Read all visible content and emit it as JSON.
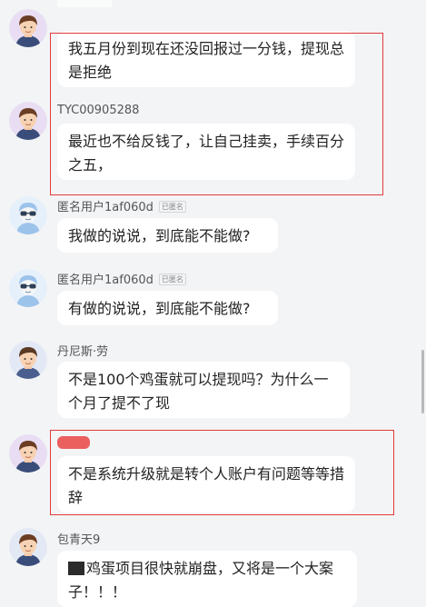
{
  "messages": [
    {
      "name": "",
      "anonymous": false,
      "avatar_icon": "man-avatar-icon",
      "text": "我五月份到现在还没回报过一分钱，提现总是拒绝"
    },
    {
      "name": "TYC00905288",
      "anonymous": false,
      "avatar_icon": "man-avatar-icon",
      "text": "最近也不给反钱了，让自己挂卖，手续百分之五，"
    },
    {
      "name": "匿名用户1af060d",
      "anonymous": true,
      "avatar_icon": "anonymous-avatar-icon",
      "text": "我做的说说，到底能不能做?"
    },
    {
      "name": "匿名用户1af060d",
      "anonymous": true,
      "avatar_icon": "anonymous-avatar-icon",
      "text": "有做的说说，到底能不能做?"
    },
    {
      "name": "丹尼斯·劳",
      "anonymous": false,
      "avatar_icon": "man-avatar-icon",
      "text": "不是100个鸡蛋就可以提现吗？为什么一个月了提不了现"
    },
    {
      "name": "",
      "anonymous": false,
      "avatar_icon": "man-avatar-icon",
      "text": "不是系统升级就是转个人账户有问题等等措辞"
    },
    {
      "name": "包青天9",
      "anonymous": false,
      "avatar_icon": "man-avatar-icon",
      "text": "鸡蛋项目很快就崩盘，又将是一个大案子！！！"
    }
  ],
  "anon_badge_label": "已匿名",
  "colors": {
    "background": "#f3f4f6",
    "bubble": "#ffffff",
    "highlight_box": "#e23a3a"
  }
}
